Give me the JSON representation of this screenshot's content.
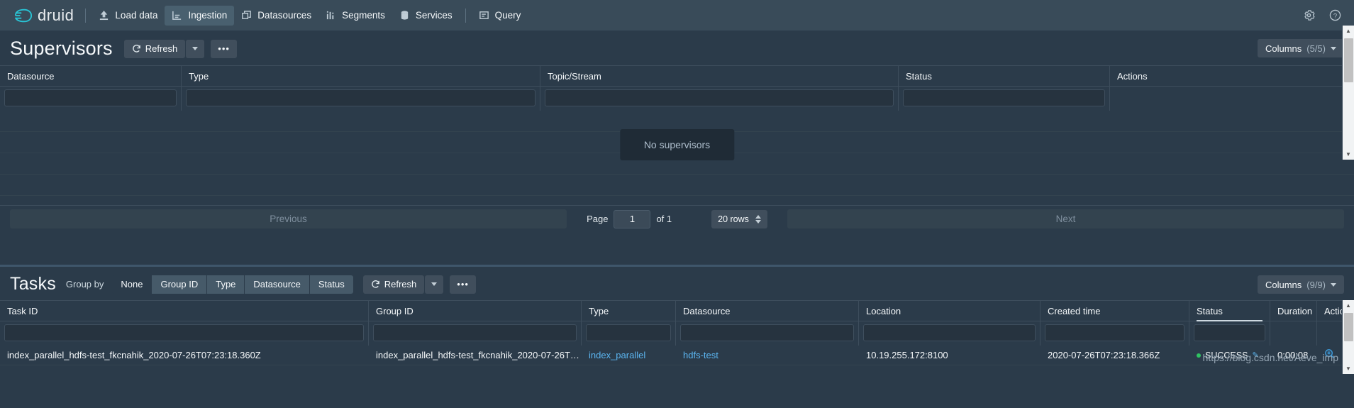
{
  "header": {
    "brand": "druid",
    "brand_icon": "druid-logo-icon",
    "nav": [
      {
        "label": "Load data",
        "icon": "upload-icon",
        "active": false
      },
      {
        "label": "Ingestion",
        "icon": "ingestion-icon",
        "active": true
      },
      {
        "label": "Datasources",
        "icon": "datasources-icon",
        "active": false
      },
      {
        "label": "Segments",
        "icon": "segments-icon",
        "active": false
      },
      {
        "label": "Services",
        "icon": "database-icon",
        "active": false
      },
      {
        "label": "Query",
        "icon": "query-icon",
        "active": false
      }
    ],
    "settings_icon": "gear-icon",
    "help_icon": "help-icon"
  },
  "supervisors": {
    "title": "Supervisors",
    "refresh_label": "Refresh",
    "more_label": "•••",
    "columns_label": "Columns",
    "columns_count": "(5/5)",
    "headers": [
      "Datasource",
      "Type",
      "Topic/Stream",
      "Status",
      "Actions"
    ],
    "empty_message": "No supervisors",
    "pagination": {
      "previous": "Previous",
      "page_label": "Page",
      "page_value": "1",
      "of_label": "of 1",
      "rows_label": "20 rows",
      "next": "Next"
    }
  },
  "tasks": {
    "title": "Tasks",
    "group_by_label": "Group by",
    "group_by_options": [
      "None",
      "Group ID",
      "Type",
      "Datasource",
      "Status"
    ],
    "group_by_active": "None",
    "refresh_label": "Refresh",
    "more_label": "•••",
    "columns_label": "Columns",
    "columns_count": "(9/9)",
    "headers": [
      "Task ID",
      "Group ID",
      "Type",
      "Datasource",
      "Location",
      "Created time",
      "Status",
      "Duration",
      "Actions"
    ],
    "sorted_header": "Status",
    "rows": [
      {
        "task_id": "index_parallel_hdfs-test_fkcnahik_2020-07-26T07:23:18.360Z",
        "group_id": "index_parallel_hdfs-test_fkcnahik_2020-07-26T0...",
        "type": "index_parallel",
        "datasource": "hdfs-test",
        "location": "10.19.255.172:8100",
        "created_time": "2020-07-26T07:23:18.366Z",
        "status": "SUCCESS",
        "status_color": "#2fc462",
        "duration": "0:00:08",
        "actions": [
          "view-icon",
          "wrench-icon"
        ]
      }
    ]
  },
  "watermark": "https://blog.csdn.net/Aeve_imp"
}
